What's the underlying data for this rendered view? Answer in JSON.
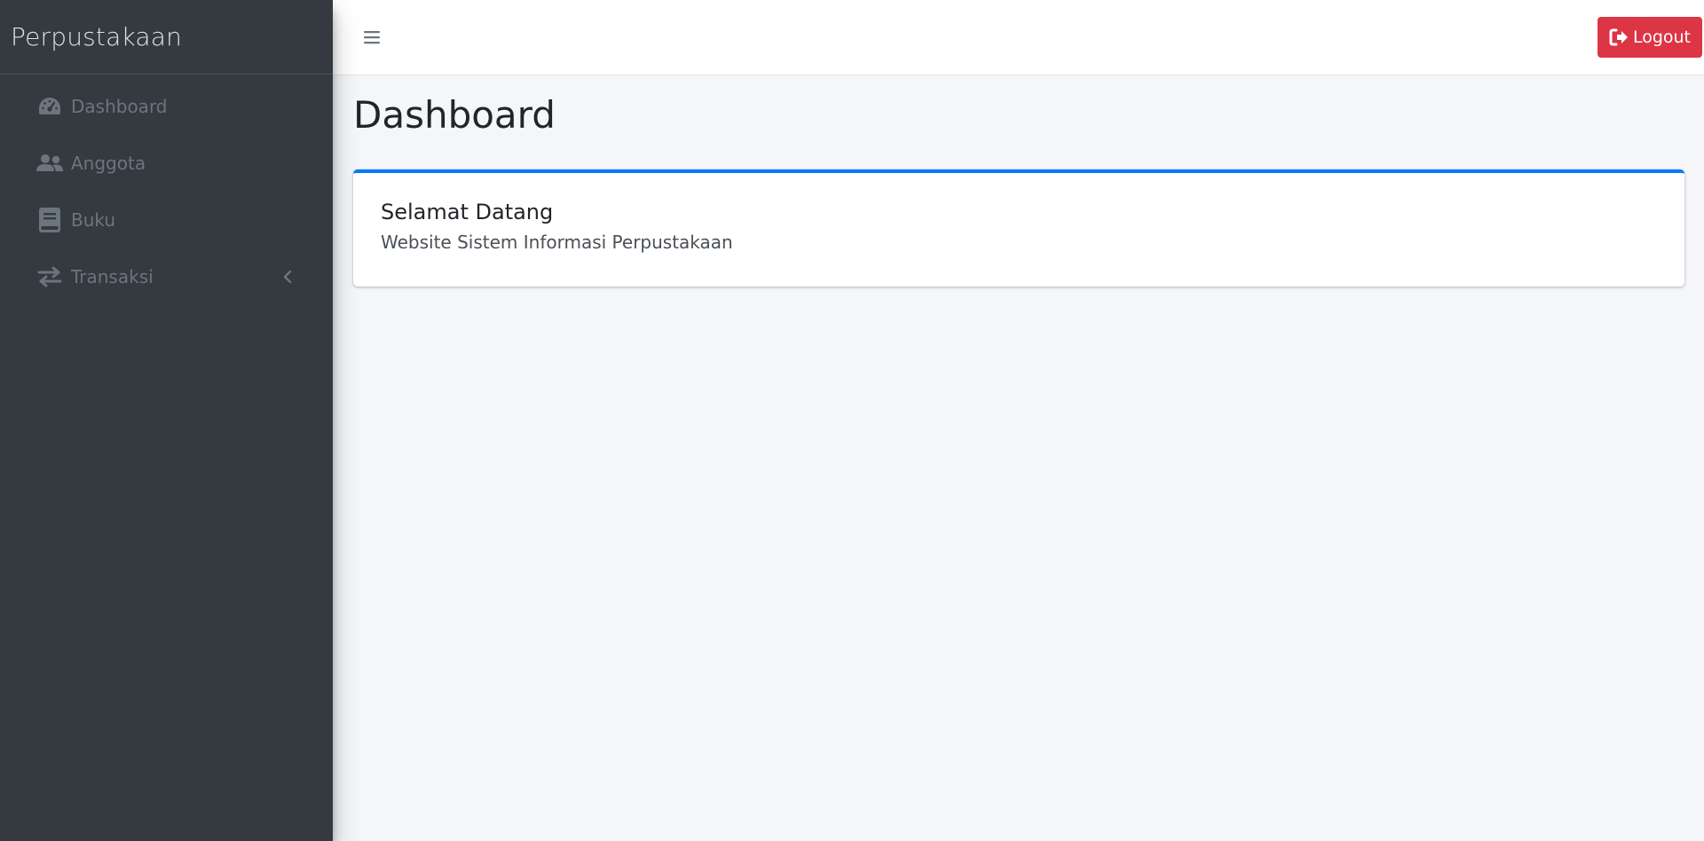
{
  "sidebar": {
    "brand": "Perpustakaan",
    "items": [
      {
        "label": "Dashboard",
        "icon": "tachometer-icon"
      },
      {
        "label": "Anggota",
        "icon": "users-icon"
      },
      {
        "label": "Buku",
        "icon": "book-icon"
      },
      {
        "label": "Transaksi",
        "icon": "exchange-icon",
        "has_submenu": true
      }
    ]
  },
  "topbar": {
    "toggle_icon": "hamburger-icon",
    "logout_label": "Logout",
    "logout_icon": "sign-out-icon"
  },
  "main": {
    "page_title": "Dashboard",
    "card": {
      "title": "Selamat Datang",
      "text": "Website Sistem Informasi Perpustakaan"
    }
  },
  "colors": {
    "sidebar_bg": "#343a40",
    "accent": "#007bff",
    "danger": "#dc3545",
    "content_bg": "#f4f6f9",
    "nav_text": "#6c757d"
  }
}
